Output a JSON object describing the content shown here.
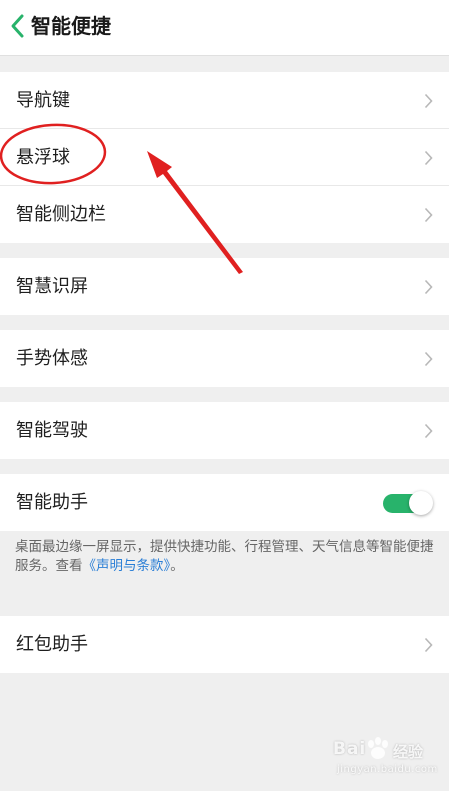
{
  "header": {
    "title": "智能便捷",
    "back_icon": "chevron-left-icon"
  },
  "colors": {
    "accent": "#28b36b",
    "link": "#2b7fd6",
    "annotation": "#e02020"
  },
  "groups": [
    {
      "items": [
        {
          "label": "导航键",
          "icon": "chevron-right-icon"
        },
        {
          "label": "悬浮球",
          "icon": "chevron-right-icon"
        },
        {
          "label": "智能侧边栏",
          "icon": "chevron-right-icon"
        }
      ]
    },
    {
      "items": [
        {
          "label": "智慧识屏",
          "icon": "chevron-right-icon"
        }
      ]
    },
    {
      "items": [
        {
          "label": "手势体感",
          "icon": "chevron-right-icon"
        }
      ]
    },
    {
      "items": [
        {
          "label": "智能驾驶",
          "icon": "chevron-right-icon"
        }
      ]
    },
    {
      "items": [
        {
          "label": "智能助手",
          "toggle": true
        }
      ]
    },
    {
      "items": [
        {
          "label": "红包助手",
          "icon": "chevron-right-icon"
        }
      ]
    }
  ],
  "assistant_description": {
    "text": "桌面最边缘一屏显示，提供快捷功能、行程管理、天气信息等智能便捷服务。查看",
    "link_text": "《声明与条款》",
    "suffix": "。"
  },
  "watermark": {
    "brand": "Bai",
    "brand_suffix": "经验",
    "domain": "jingyan.baidu.com"
  }
}
